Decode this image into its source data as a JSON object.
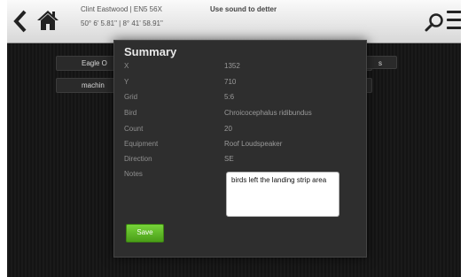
{
  "header": {
    "location_line1": "Clint Eastwood | EN5 56X",
    "location_line2": "50° 6' 5.81\" | 8° 41' 58.91\"",
    "mode_title": "Use sound to detter"
  },
  "background_buttons": [
    {
      "label": "Eagle O"
    },
    {
      "label": "s"
    },
    {
      "label": "machin"
    }
  ],
  "summary": {
    "title": "Summary",
    "fields": [
      {
        "label": "X",
        "value": "1352"
      },
      {
        "label": "Y",
        "value": "710"
      },
      {
        "label": "Grid",
        "value": "5:6"
      },
      {
        "label": "Bird",
        "value": "Chroicocephalus ridibundus"
      },
      {
        "label": "Count",
        "value": "20"
      },
      {
        "label": "Equipment",
        "value": "Roof Loudspeaker"
      },
      {
        "label": "Direction",
        "value": "SE"
      }
    ],
    "notes_label": "Notes",
    "notes_value": "birds left the landing strip area",
    "save_label": "Save"
  },
  "colors": {
    "accent_green": "#5bb526",
    "dialog_bg": "#2e2e2e",
    "topbar_bg": "#e8e8e8"
  },
  "icons": [
    "back-icon",
    "home-icon",
    "search-icon",
    "menu-icon"
  ]
}
